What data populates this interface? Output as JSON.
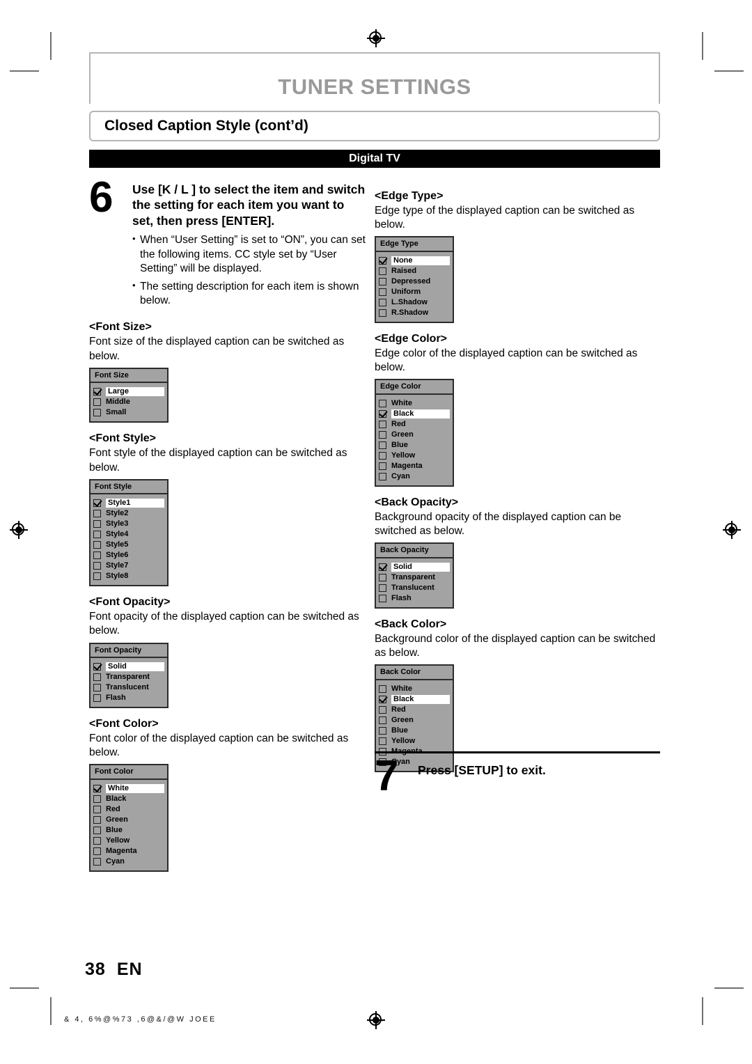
{
  "document": {
    "chapter_title": "TUNER SETTINGS",
    "section_title": "Closed Caption Style (cont’d)",
    "mode_banner": "Digital TV",
    "page_number": "38",
    "page_lang": "EN",
    "footer_code": "& 4, 6%@%73  ,6@&/@W   JOEE",
    "accent_gray": "#9a9a9a",
    "banner_black": "#000000",
    "osd_background": "#a3a3a3",
    "osd_border": "#2b2b2b",
    "osd_highlight": "#ffffff"
  },
  "step6": {
    "number": "6",
    "heading": "Use [K / L ] to select the item and switch the setting for each item you want to set, then press [ENTER].",
    "bullets": [
      "When “User Setting” is set to “ON”, you can set the following items. CC style set by “User Setting” will be displayed.",
      "The setting description for each item is shown below."
    ]
  },
  "step7": {
    "number": "7",
    "text": "Press [SETUP] to exit."
  },
  "left_items": [
    {
      "label": "<Font Size>",
      "description": "Font size of the displayed caption can be switched as below.",
      "osd_title": "Font Size",
      "options": [
        "Large",
        "Middle",
        "Small"
      ],
      "selected": "Large"
    },
    {
      "label": "<Font Style>",
      "description": "Font style of the displayed caption can be switched as below.",
      "osd_title": "Font Style",
      "options": [
        "Style1",
        "Style2",
        "Style3",
        "Style4",
        "Style5",
        "Style6",
        "Style7",
        "Style8"
      ],
      "selected": "Style1"
    },
    {
      "label": "<Font Opacity>",
      "description": "Font opacity of the displayed caption can be switched as below.",
      "osd_title": "Font Opacity",
      "options": [
        "Solid",
        "Transparent",
        "Translucent",
        "Flash"
      ],
      "selected": "Solid"
    },
    {
      "label": "<Font Color>",
      "description": "Font color of the displayed caption can be switched as below.",
      "osd_title": "Font Color",
      "options": [
        "White",
        "Black",
        "Red",
        "Green",
        "Blue",
        "Yellow",
        "Magenta",
        "Cyan"
      ],
      "selected": "White"
    }
  ],
  "right_items": [
    {
      "label": "<Edge Type>",
      "description": "Edge type of the displayed caption can be switched as below.",
      "osd_title": "Edge Type",
      "options": [
        "None",
        "Raised",
        "Depressed",
        "Uniform",
        "L.Shadow",
        "R.Shadow"
      ],
      "selected": "None"
    },
    {
      "label": "<Edge Color>",
      "description": "Edge color of the displayed caption can be switched as below.",
      "osd_title": "Edge Color",
      "options": [
        "White",
        "Black",
        "Red",
        "Green",
        "Blue",
        "Yellow",
        "Magenta",
        "Cyan"
      ],
      "selected": "Black"
    },
    {
      "label": "<Back Opacity>",
      "description": "Background opacity of the displayed caption can be switched as below.",
      "osd_title": "Back Opacity",
      "options": [
        "Solid",
        "Transparent",
        "Translucent",
        "Flash"
      ],
      "selected": "Solid"
    },
    {
      "label": "<Back Color>",
      "description": "Background color of the displayed caption can be switched as below.",
      "osd_title": "Back Color",
      "options": [
        "White",
        "Black",
        "Red",
        "Green",
        "Blue",
        "Yellow",
        "Magenta",
        "Cyan"
      ],
      "selected": "Black"
    }
  ]
}
